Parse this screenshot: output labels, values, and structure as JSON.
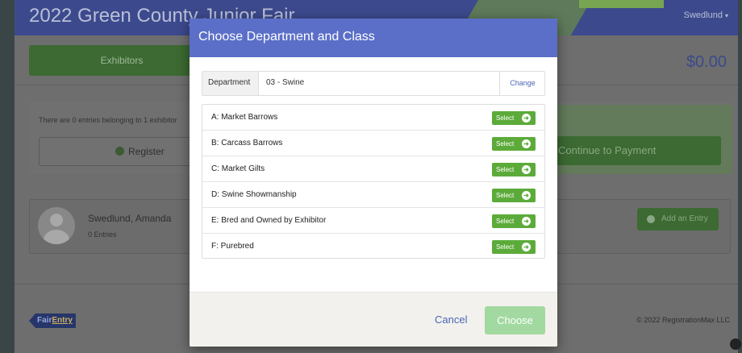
{
  "header": {
    "title": "2022 Green County Junior Fair",
    "user": "Swedlund"
  },
  "nav": {
    "exhibitors_label": "Exhibitors",
    "total": "$0.00"
  },
  "info": {
    "text": "There are 0 entries belonging to 1 exhibitor",
    "register_label": "Register",
    "payment_label": "Continue to Payment"
  },
  "exhibitor": {
    "name": "Swedlund, Amanda",
    "entries": "0 Entries",
    "add_entry_label": "Add an Entry"
  },
  "footer": {
    "logo_fair": "Fair",
    "logo_entry": "Entry",
    "copyright": "© 2022 RegistrationMax LLC"
  },
  "modal": {
    "title": "Choose Department and Class",
    "department_label": "Department",
    "department_value": "03 - Swine",
    "change_label": "Change",
    "select_label": "Select",
    "classes": [
      {
        "name": "A: Market Barrows"
      },
      {
        "name": "B: Carcass Barrows"
      },
      {
        "name": "C: Market Gilts"
      },
      {
        "name": "D: Swine Showmanship"
      },
      {
        "name": "E: Bred and Owned by Exhibitor"
      },
      {
        "name": "F: Purebred"
      }
    ],
    "cancel_label": "Cancel",
    "choose_label": "Choose"
  },
  "icons": {
    "select_arrow": "arrow-right-circle-icon",
    "register": "plus-circle-icon",
    "add_entry": "plus-circle-icon",
    "user_caret": "caret-down-icon",
    "avatar": "user-silhouette-icon"
  },
  "colors": {
    "header_bg": "#3c4a8d",
    "modal_header": "#5b6fc8",
    "select_green": "#5cab3a",
    "choose_disabled": "#a1d9a0",
    "link_blue": "#4a67b6"
  }
}
